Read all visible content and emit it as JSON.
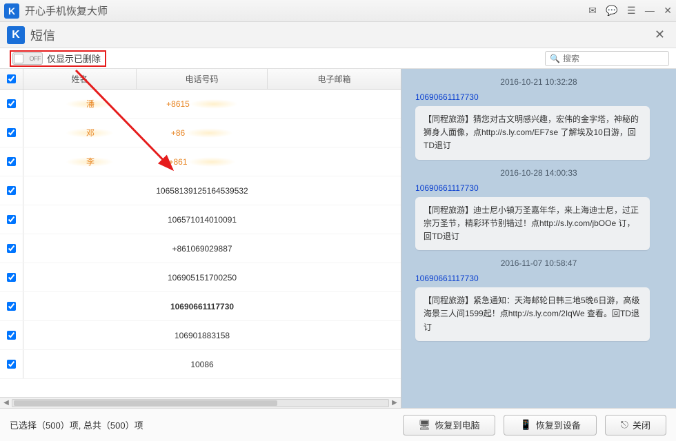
{
  "app": {
    "title": "开心手机恢复大师",
    "icon_letter": "K"
  },
  "subheader": {
    "title": "短信",
    "icon_letter": "K"
  },
  "filter": {
    "toggle_text": "OFF",
    "label": "仅显示已删除"
  },
  "search": {
    "placeholder": "搜索"
  },
  "table": {
    "headers": {
      "name": "姓名",
      "phone": "电话号码",
      "mail": "电子邮箱"
    },
    "rows": [
      {
        "checked": true,
        "name": "潘",
        "phone": "+8615",
        "orange": true,
        "smudge": true
      },
      {
        "checked": true,
        "name": "邓",
        "phone": "+86",
        "orange": true,
        "smudge": true
      },
      {
        "checked": true,
        "name": "李",
        "phone": "+861",
        "orange": true,
        "smudge": true
      },
      {
        "checked": true,
        "name": "",
        "phone": "10658139125164539532",
        "orange": false
      },
      {
        "checked": true,
        "name": "",
        "phone": "106571014010091",
        "orange": false
      },
      {
        "checked": true,
        "name": "",
        "phone": "+861069029887",
        "orange": false
      },
      {
        "checked": true,
        "name": "",
        "phone": "106905151700250",
        "orange": false
      },
      {
        "checked": true,
        "name": "",
        "phone": "10690661117730",
        "orange": false,
        "selected": true
      },
      {
        "checked": true,
        "name": "",
        "phone": "106901883158",
        "orange": false
      },
      {
        "checked": true,
        "name": "",
        "phone": "10086",
        "orange": false
      }
    ]
  },
  "messages": [
    {
      "time": "2016-10-21 10:32:28",
      "sender": "10690661117730",
      "body": "【同程旅游】猜您对古文明感兴趣，宏伟的金字塔，神秘的狮身人面像，点http://s.ly.com/EF7se 了解埃及10日游，回TD退订"
    },
    {
      "time": "2016-10-28 14:00:33",
      "sender": "10690661117730",
      "body": "【同程旅游】迪士尼小镇万圣嘉年华，来上海迪士尼，过正宗万圣节，精彩环节别错过！点http://s.ly.com/jbOOe 订，回TD退订"
    },
    {
      "time": "2016-11-07 10:58:47",
      "sender": "10690661117730",
      "body": "【同程旅游】紧急通知：天海邮轮日韩三地5晚6日游，高级海景三人间1599起！点http://s.ly.com/2IqWe 查看。回TD退订"
    }
  ],
  "footer": {
    "status": "已选择（500）项, 总共（500）项",
    "btn_pc": "恢复到电脑",
    "btn_device": "恢复到设备",
    "btn_close": "关闭"
  }
}
